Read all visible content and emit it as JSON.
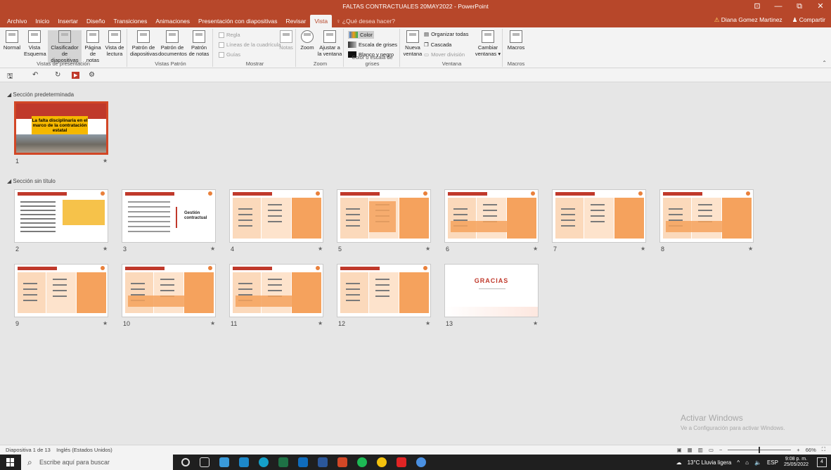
{
  "window": {
    "title": "FALTAS CONTRACTUALES 20MAY2022 - PowerPoint",
    "buttons": [
      "⊡",
      "—",
      "⧉",
      "✕"
    ]
  },
  "tabs": [
    "Archivo",
    "Inicio",
    "Insertar",
    "Diseño",
    "Transiciones",
    "Animaciones",
    "Presentación con diapositivas",
    "Revisar",
    "Vista"
  ],
  "tell_me": "♀ ¿Qué desea hacer?",
  "user": {
    "name": "Diana Gomez Martinez",
    "share": "Compartir"
  },
  "ribbon": {
    "groups": {
      "presentation_views": "Vistas de presentación",
      "master_views": "Vistas Patrón",
      "show": "Mostrar",
      "zoom": "Zoom",
      "color": "Color o escala de grises",
      "window": "Ventana",
      "macros": "Macros"
    },
    "buttons": {
      "normal": "Normal",
      "outline": "Vista Esquema",
      "sorter": "Clasificador de diapositivas",
      "notes_page": "Página de notas",
      "reading": "Vista de lectura",
      "slide_master": "Patrón de diapositivas",
      "handout_master": "Patrón de documentos",
      "notes_master": "Patrón de notas",
      "notes": "Notas",
      "zoom": "Zoom",
      "fit_window": "Ajustar a la ventana",
      "new_window": "Nueva ventana",
      "switch_windows": "Cambiar ventanas ▾",
      "macros": "Macros"
    },
    "checkboxes": {
      "ruler": "Regla",
      "gridlines": "Líneas de la cuadrícula",
      "guides": "Guías"
    },
    "color_options": {
      "color": "Color",
      "grayscale": "Escala de grises",
      "bw": "Blanco y negro"
    },
    "window_options": {
      "arrange": "Organizar todas",
      "cascade": "Cascada",
      "move_split": "Mover división"
    }
  },
  "sections": {
    "default": "Sección predeterminada",
    "untitled": "Sección sin título"
  },
  "slides": [
    {
      "num": "1",
      "title": "La falta disciplinaria en el marco de la contratación estatal"
    },
    {
      "num": "2"
    },
    {
      "num": "3",
      "label": "Gestión contractual"
    },
    {
      "num": "4"
    },
    {
      "num": "5"
    },
    {
      "num": "6"
    },
    {
      "num": "7"
    },
    {
      "num": "8"
    },
    {
      "num": "9"
    },
    {
      "num": "10"
    },
    {
      "num": "11"
    },
    {
      "num": "12"
    },
    {
      "num": "13",
      "label": "GRACIAS"
    }
  ],
  "star": "★",
  "status": {
    "slide": "Diapositiva 1 de 13",
    "language": "Inglés (Estados Unidos)",
    "zoom": "66%"
  },
  "watermark": {
    "line1": "Activar Windows",
    "line2": "Ve a Configuración para activar Windows."
  },
  "taskbar": {
    "search": "Escribe aquí para buscar",
    "weather": "13°C Lluvia ligera",
    "lang": "ESP",
    "time": "9:08 p. m.",
    "date": "25/05/2022",
    "notifications": "4"
  },
  "colors": {
    "accent": "#b7472a",
    "slide_red": "#c0392b",
    "slide_orange": "#f5a25d",
    "slide_peach": "#fbd9bb"
  }
}
